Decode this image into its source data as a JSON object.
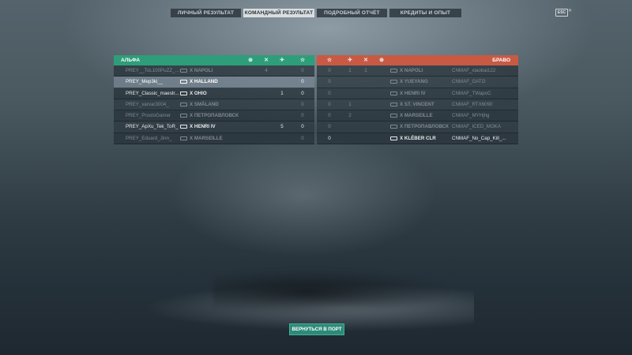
{
  "tabs": [
    {
      "label": "ЛИЧНЫЙ РЕЗУЛЬТАТ",
      "active": false
    },
    {
      "label": "КОМАНДНЫЙ РЕЗУЛЬТАТ",
      "active": true
    },
    {
      "label": "ПОДРОБНЫЙ ОТЧЁТ",
      "active": false
    },
    {
      "label": "КРЕДИТЫ И ОПЫТ",
      "active": false
    }
  ],
  "corner": {
    "badge": "ESC",
    "close": "✕"
  },
  "teams": {
    "alpha": {
      "name": "АЛЬФА",
      "color": "#2d9e79",
      "header_icons": [
        "ribbon-icon",
        "crossed-guns-icon",
        "plane-icon",
        "star-icon"
      ],
      "rows": [
        {
          "player": "PREY__ToL100PuZZ_...",
          "ship": "X NAPOLI",
          "c1": "4",
          "c2": "",
          "c3": "",
          "c4": "0",
          "state": "dead"
        },
        {
          "player": "PREY_Mep3ki__",
          "ship": "X HALLAND",
          "c1": "",
          "c2": "",
          "c3": "",
          "c4": "0",
          "state": "highlight"
        },
        {
          "player": "PREY_Classic_maestr...",
          "ship": "X OHIO",
          "c1": "",
          "c2": "1",
          "c3": "",
          "c4": "0",
          "state": "alive"
        },
        {
          "player": "PREY_varvar3004_",
          "ship": "X SMÅLAND",
          "c1": "",
          "c2": "",
          "c3": "",
          "c4": "0",
          "state": "dead"
        },
        {
          "player": "PREY_ProstoGamer",
          "ship": "X ПЕТРОПАВЛОВСК",
          "c1": "",
          "c2": "",
          "c3": "",
          "c4": "0",
          "state": "dead"
        },
        {
          "player": "PREY_ApXu_Tek_ToR_",
          "ship": "X HENRI IV",
          "c1": "",
          "c2": "5",
          "c3": "",
          "c4": "0",
          "state": "alive"
        },
        {
          "player": "PREY_Eduard_Jinn_",
          "ship": "X MARSEILLE",
          "c1": "",
          "c2": "",
          "c3": "",
          "c4": "0",
          "state": "dead"
        }
      ]
    },
    "bravo": {
      "name": "БРАВО",
      "color": "#c85a44",
      "header_icons": [
        "star-icon",
        "plane-icon",
        "crossed-guns-icon",
        "ribbon-icon"
      ],
      "rows": [
        {
          "player": "CNMAF_xiaobai122",
          "ship": "X NAPOLI",
          "c1": "0",
          "c2": "1",
          "c3": "1",
          "c4": "",
          "state": "dead"
        },
        {
          "player": "CNMAF_GATO",
          "ship": "X YUEYANG",
          "c1": "0",
          "c2": "",
          "c3": "",
          "c4": "",
          "state": "dead"
        },
        {
          "player": "CNMAF_TWapoC",
          "ship": "X HENRI IV",
          "c1": "0",
          "c2": "",
          "c3": "",
          "c4": "",
          "state": "dead"
        },
        {
          "player": "CNMAF_RTX6090",
          "ship": "X ST. VINCENT",
          "c1": "0",
          "c2": "1",
          "c3": "",
          "c4": "",
          "state": "dead"
        },
        {
          "player": "CNMAF_MYHjhg",
          "ship": "X MARSEILLE",
          "c1": "0",
          "c2": "2",
          "c3": "",
          "c4": "",
          "state": "dead"
        },
        {
          "player": "CNMAF_ICED_MOKA",
          "ship": "X ПЕТРОПАВЛОВСК",
          "c1": "0",
          "c2": "",
          "c3": "",
          "c4": "",
          "state": "dead"
        },
        {
          "player": "CNMAF_No_Cap_Kill_...",
          "ship": "X KLÉBER CLR",
          "c1": "0",
          "c2": "",
          "c3": "",
          "c4": "",
          "state": "alive"
        }
      ]
    }
  },
  "footer": {
    "return_label": "ВЕРНУТЬСЯ В ПОРТ"
  }
}
